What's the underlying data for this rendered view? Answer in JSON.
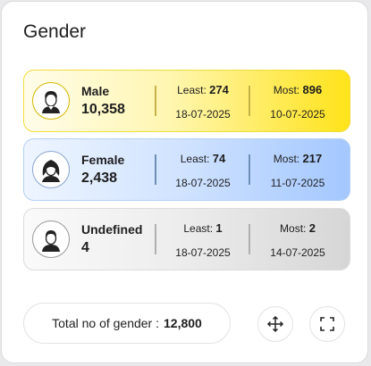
{
  "title": "Gender",
  "rows": [
    {
      "name": "Male",
      "count": "10,358",
      "least_label": "Least:",
      "least_value": "274",
      "least_date": "18-07-2025",
      "most_label": "Most:",
      "most_value": "896",
      "most_date": "10-07-2025",
      "icon": "male-avatar-icon",
      "color": "#ffe31a"
    },
    {
      "name": "Female",
      "count": "2,438",
      "least_label": "Least:",
      "least_value": "74",
      "least_date": "18-07-2025",
      "most_label": "Most:",
      "most_value": "217",
      "most_date": "11-07-2025",
      "icon": "female-avatar-icon",
      "color": "#a3c7ff"
    },
    {
      "name": "Undefined",
      "count": "4",
      "least_label": "Least:",
      "least_value": "1",
      "least_date": "18-07-2025",
      "most_label": "Most:",
      "most_value": "2",
      "most_date": "14-07-2025",
      "icon": "undefined-avatar-icon",
      "color": "#d6d6d6"
    }
  ],
  "footer": {
    "total_label": "Total no of gender :",
    "total_value": "12,800",
    "move_icon": "move-icon",
    "expand_icon": "fullscreen-icon"
  }
}
